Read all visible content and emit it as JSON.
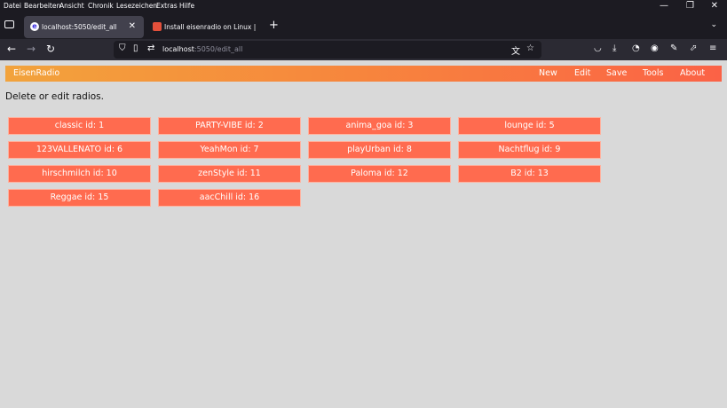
{
  "browser": {
    "menu": [
      "Datei",
      "Bearbeiten",
      "Ansicht",
      "Chronik",
      "Lesezeichen",
      "Extras",
      "Hilfe"
    ],
    "window_controls": {
      "minimize": "—",
      "restore": "❐",
      "close": "✕"
    },
    "tabs": [
      {
        "title": "localhost:5050/edit_all",
        "favicon_color": "#3b2ee0"
      },
      {
        "title": "Install eisenradio on Linux | Sna",
        "favicon_color": "#e3503b"
      }
    ],
    "new_tab": "+",
    "url": {
      "host": "localhost",
      "rest": ":5050/edit_all"
    },
    "icons": [
      "back-icon",
      "forward-icon",
      "reload-icon",
      "shield-icon",
      "page-icon",
      "permissions-icon",
      "translate-icon",
      "bookmark-star-icon",
      "pocket-icon",
      "downloads-icon",
      "extension-icon",
      "account-icon",
      "addon-icon",
      "share-icon",
      "menu-icon",
      "tab-list-icon"
    ]
  },
  "app": {
    "brand": "EisenRadio",
    "nav": [
      "New",
      "Edit",
      "Save",
      "Tools",
      "About"
    ],
    "heading": "Delete or edit radios.",
    "accent": "#ff6b4f"
  },
  "radios": [
    {
      "label": "classic id: 1"
    },
    {
      "label": "PARTY-VIBE id: 2"
    },
    {
      "label": "anima_goa id: 3"
    },
    {
      "label": "lounge id: 5"
    },
    {
      "label": "123VALLENATO id: 6"
    },
    {
      "label": "YeahMon id: 7"
    },
    {
      "label": "playUrban id: 8"
    },
    {
      "label": "Nachtflug id: 9"
    },
    {
      "label": "hirschmilch id: 10"
    },
    {
      "label": "zenStyle id: 11"
    },
    {
      "label": "Paloma id: 12"
    },
    {
      "label": "B2 id: 13"
    },
    {
      "label": "Reggae id: 15"
    },
    {
      "label": "aacChill id: 16"
    }
  ]
}
